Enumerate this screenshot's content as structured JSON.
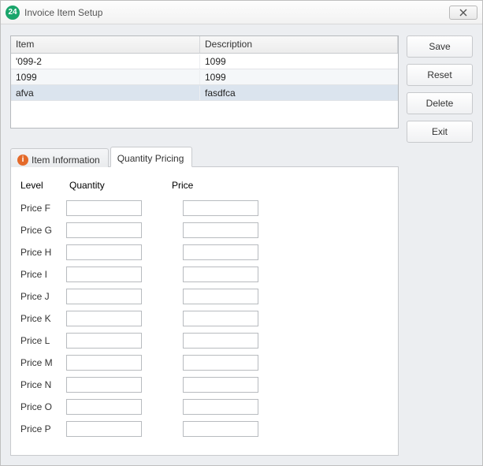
{
  "window": {
    "title": "Invoice Item Setup",
    "app_icon_text": "24"
  },
  "buttons": {
    "save": "Save",
    "reset": "Reset",
    "delete": "Delete",
    "exit": "Exit"
  },
  "grid": {
    "headers": {
      "item": "Item",
      "description": "Description"
    },
    "rows": [
      {
        "item": "'099-2",
        "description": "1099"
      },
      {
        "item": "1099",
        "description": "1099"
      },
      {
        "item": "afva",
        "description": "fasdfca"
      }
    ],
    "selected_index": 2
  },
  "tabs": {
    "item_info": "Item Information",
    "qty_pricing": "Quantity Pricing",
    "active": "qty_pricing"
  },
  "qty_pricing": {
    "headers": {
      "level": "Level",
      "quantity": "Quantity",
      "price": "Price"
    },
    "rows": [
      {
        "level": "Price F",
        "quantity": "",
        "price": ""
      },
      {
        "level": "Price G",
        "quantity": "",
        "price": ""
      },
      {
        "level": "Price H",
        "quantity": "",
        "price": ""
      },
      {
        "level": "Price I",
        "quantity": "",
        "price": ""
      },
      {
        "level": "Price J",
        "quantity": "",
        "price": ""
      },
      {
        "level": "Price K",
        "quantity": "",
        "price": ""
      },
      {
        "level": "Price L",
        "quantity": "",
        "price": ""
      },
      {
        "level": "Price M",
        "quantity": "",
        "price": ""
      },
      {
        "level": "Price N",
        "quantity": "",
        "price": ""
      },
      {
        "level": "Price O",
        "quantity": "",
        "price": ""
      },
      {
        "level": "Price P",
        "quantity": "",
        "price": ""
      }
    ]
  }
}
